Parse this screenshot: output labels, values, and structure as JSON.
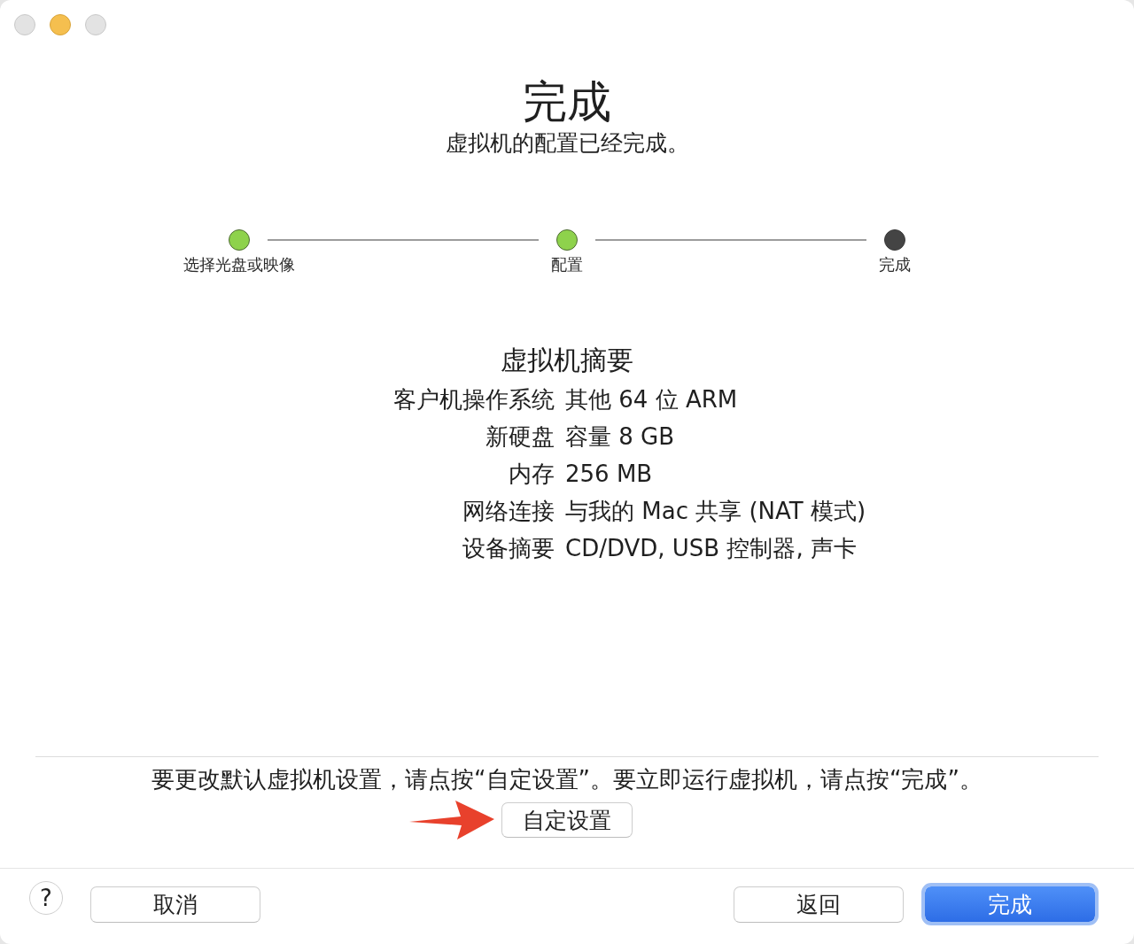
{
  "window": {
    "controls": [
      {
        "kind": "close",
        "enabled": false
      },
      {
        "kind": "minimize",
        "enabled": true
      },
      {
        "kind": "zoom",
        "enabled": false
      }
    ]
  },
  "header": {
    "title": "完成",
    "subtitle": "虚拟机的配置已经完成。"
  },
  "steps": [
    {
      "label": "选择光盘或映像",
      "completed": true
    },
    {
      "label": "配置",
      "completed": true
    },
    {
      "label": "完成",
      "completed": false
    }
  ],
  "summary": {
    "title": "虚拟机摘要",
    "rows": [
      {
        "label": "客户机操作系统",
        "value": "其他 64 位 ARM"
      },
      {
        "label": "新硬盘",
        "value": "容量 8 GB"
      },
      {
        "label": "内存",
        "value": "256 MB"
      },
      {
        "label": "网络连接",
        "value": "与我的 Mac 共享 (NAT 模式)"
      },
      {
        "label": "设备摘要",
        "value": "CD/DVD, USB 控制器, 声卡"
      }
    ]
  },
  "customize": {
    "hint": "要更改默认虚拟机设置，请点按“自定设置”。要立即运行虚拟机，请点按“完成”。",
    "button": "自定设置"
  },
  "footer": {
    "help": "?",
    "left_buttons": [
      {
        "label": "取消",
        "default": false
      }
    ],
    "right_buttons": [
      {
        "label": "返回",
        "default": false
      },
      {
        "label": "完成",
        "default": true
      }
    ]
  }
}
